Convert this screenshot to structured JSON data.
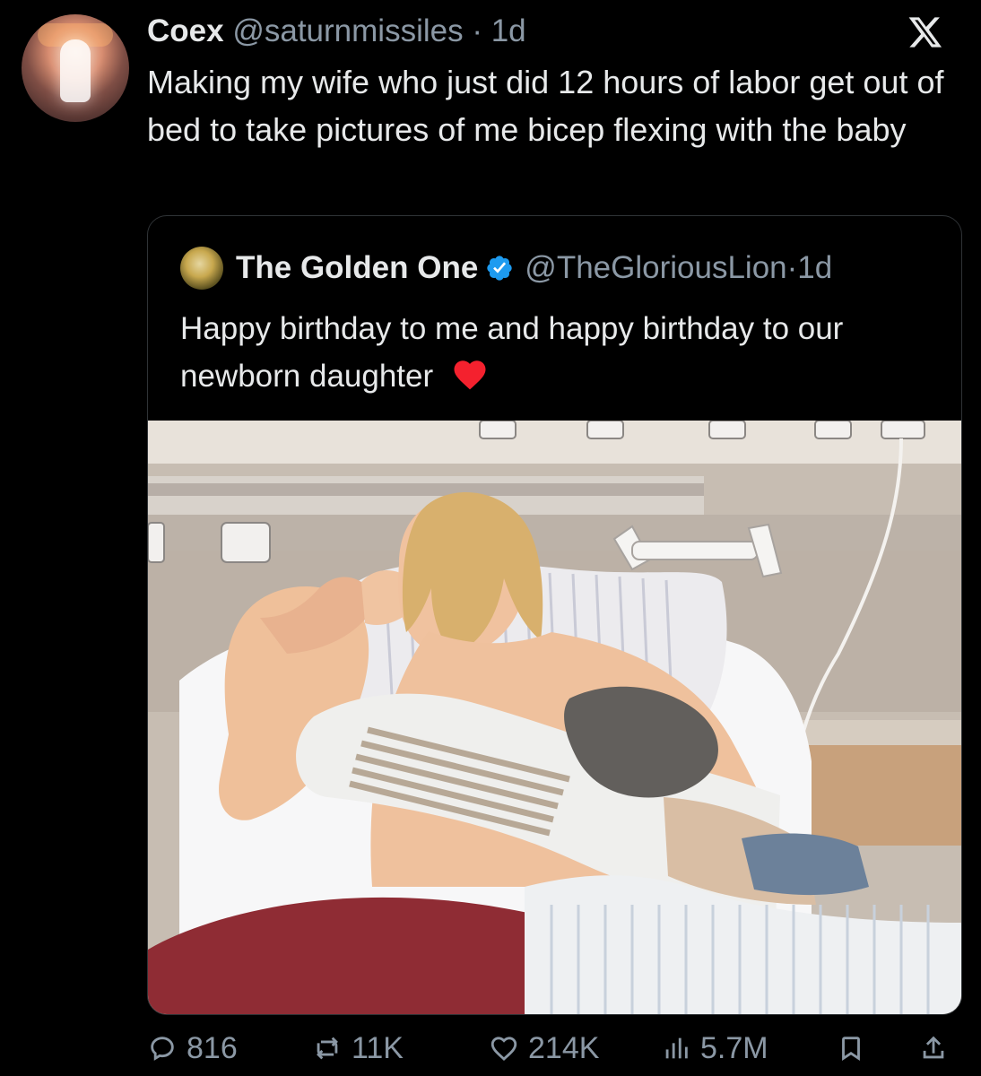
{
  "tweet": {
    "author_name": "Coex",
    "author_handle": "@saturnmissiles",
    "dot": "·",
    "timestamp": "1d",
    "text": "Making my wife who just did 12 hours of labor get out of bed to take pictures of me bicep flexing with the baby"
  },
  "quoted_tweet": {
    "author_name": "The Golden One",
    "author_handle": "@TheGloriousLion",
    "dot": "·",
    "timestamp": "1d",
    "text": "Happy birthday to me and happy birthday to our newborn daughter",
    "emoji": "red-heart"
  },
  "actions": {
    "replies": "816",
    "retweets": "11K",
    "likes": "214K",
    "views": "5.7M"
  },
  "icons": {
    "logo": "x-logo-icon",
    "verified": "verified-badge-icon",
    "reply": "reply-icon",
    "retweet": "retweet-icon",
    "like": "heart-icon",
    "views": "views-icon",
    "bookmark": "bookmark-icon",
    "share": "share-icon"
  },
  "colors": {
    "background": "#000000",
    "primary_text": "#e7e9ea",
    "secondary_text": "#8b98a5",
    "border": "#2f3336",
    "verified_blue": "#1d9bf0"
  }
}
